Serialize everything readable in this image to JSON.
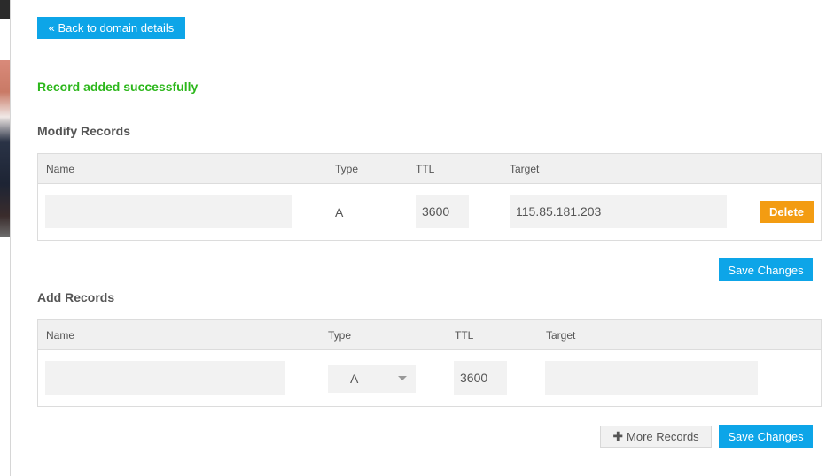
{
  "back_button": {
    "label": "« Back to domain details"
  },
  "success_message": "Record added successfully",
  "modify": {
    "title": "Modify Records",
    "columns": {
      "name": "Name",
      "type": "Type",
      "ttl": "TTL",
      "target": "Target"
    },
    "row": {
      "name": "",
      "type": "A",
      "ttl": "3600",
      "target": "115.85.181.203",
      "delete_label": "Delete"
    },
    "save_label": "Save Changes"
  },
  "add": {
    "title": "Add Records",
    "columns": {
      "name": "Name",
      "type": "Type",
      "ttl": "TTL",
      "target": "Target"
    },
    "row": {
      "name": "",
      "type": "A",
      "ttl": "3600",
      "target": ""
    },
    "more_label": "More Records",
    "more_icon": "plus-icon",
    "save_label": "Save Changes"
  },
  "colors": {
    "accent": "#0da5e8",
    "success": "#2cb71b",
    "danger": "#f39c12"
  }
}
